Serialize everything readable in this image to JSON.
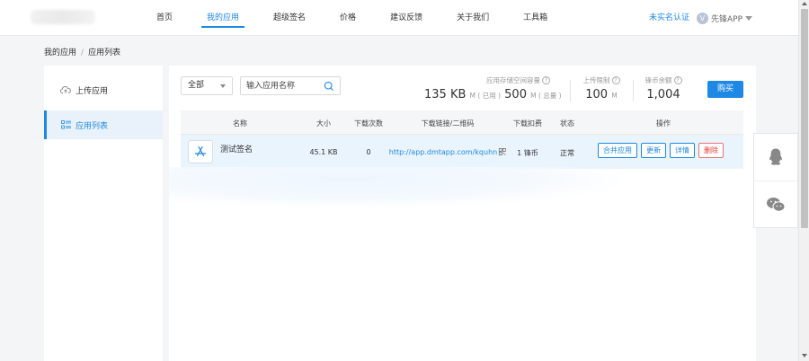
{
  "nav": {
    "items": [
      {
        "label": "首页",
        "active": false
      },
      {
        "label": "我的应用",
        "active": true
      },
      {
        "label": "超级签名",
        "active": false
      },
      {
        "label": "价格",
        "active": false
      },
      {
        "label": "建议反馈",
        "active": false
      },
      {
        "label": "关于我们",
        "active": false
      },
      {
        "label": "工具箱",
        "active": false
      }
    ],
    "realname": "未实名认证",
    "user": {
      "avatar": "V",
      "name": "先锋APP"
    }
  },
  "breadcrumb": {
    "root": "我的应用",
    "sep": "/",
    "current": "应用列表"
  },
  "sidebar": {
    "items": [
      {
        "label": "上传应用",
        "icon": "cloud-upload-icon"
      },
      {
        "label": "应用列表",
        "icon": "list-icon"
      }
    ]
  },
  "filter": {
    "select_value": "全部",
    "search_placeholder": "输入应用名称"
  },
  "stats": {
    "storage": {
      "label": "应用存储空间容量",
      "used": "135 KB",
      "used_unit": "M ( 已用 )",
      "total": "500",
      "total_unit": "M ( 总量 )"
    },
    "upload_limit": {
      "label": "上传限制",
      "value": "100",
      "unit": "M"
    },
    "coins": {
      "label": "锋币余额",
      "value": "1,004"
    },
    "buy_label": "购买"
  },
  "table": {
    "headers": [
      "名称",
      "大小",
      "下载次数",
      "下载链接/二维码",
      "下载扣费",
      "状态",
      "操作"
    ],
    "rows": [
      {
        "name": "测试签名",
        "size": "45.1 KB",
        "downloads": "0",
        "link": "http://app.dmtapp.com/kquhn",
        "fee": "1 锋币",
        "status": "正常",
        "actions": [
          "合并应用",
          "更新",
          "详情",
          "删除"
        ]
      }
    ]
  },
  "colors": {
    "accent": "#1e88e5",
    "danger": "#e53935"
  }
}
